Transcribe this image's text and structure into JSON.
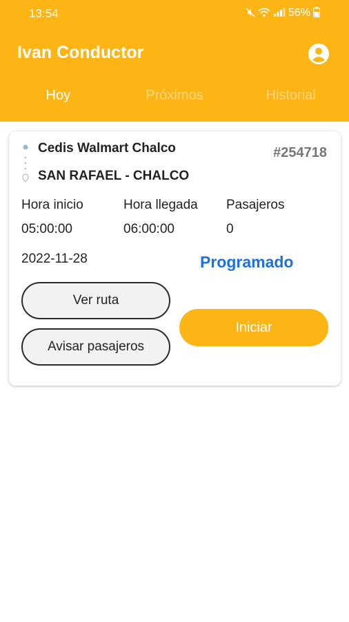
{
  "status_bar": {
    "time": "13:54",
    "battery": "56%",
    "icons": [
      "mute-icon",
      "wifi-icon",
      "signal-icon",
      "battery-icon"
    ]
  },
  "header": {
    "title": "Ivan Conductor",
    "account_icon": "account-circle-icon"
  },
  "tabs": [
    {
      "label": "Hoy",
      "active": true
    },
    {
      "label": "Próximos",
      "active": false
    },
    {
      "label": "Historial",
      "active": false
    }
  ],
  "trip": {
    "origin": "Cedis Walmart Chalco",
    "destination": "SAN RAFAEL - CHALCO",
    "id": "#254718",
    "start_label": "Hora inicio",
    "start_time": "05:00:00",
    "arrival_label": "Hora llegada",
    "arrival_time": "06:00:00",
    "passengers_label": "Pasajeros",
    "passengers": "0",
    "date": "2022-11-28",
    "status": "Programado",
    "buttons": {
      "view_route": "Ver ruta",
      "notify": "Avisar pasajeros",
      "start": "Iniciar"
    }
  },
  "colors": {
    "primary": "#FDB515",
    "status_blue": "#1E6FE0"
  }
}
